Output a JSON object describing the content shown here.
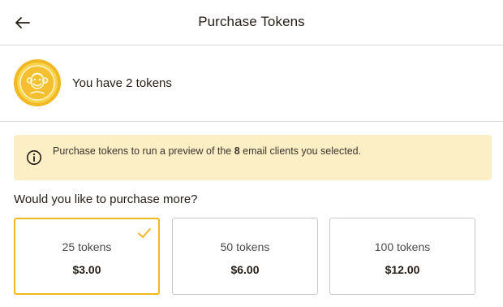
{
  "header": {
    "title": "Purchase Tokens",
    "back_icon": "arrow-left-icon"
  },
  "balance": {
    "text": "You have 2 tokens",
    "icon": "coin-icon"
  },
  "notice": {
    "icon": "info-icon",
    "text_before": "Purchase tokens to run a preview of the ",
    "client_count": "8",
    "text_after": " email clients you selected."
  },
  "purchase": {
    "question": "Would you like to purchase more?",
    "options": [
      {
        "amount": "25 tokens",
        "price": "$3.00",
        "selected": true
      },
      {
        "amount": "50 tokens",
        "price": "$6.00",
        "selected": false
      },
      {
        "amount": "100 tokens",
        "price": "$12.00",
        "selected": false
      }
    ]
  },
  "colors": {
    "accent": "#f0b823",
    "notice_bg": "#fcefc5",
    "text": "#241c15"
  }
}
